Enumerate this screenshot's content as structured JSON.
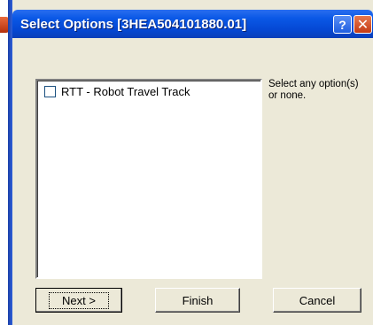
{
  "window": {
    "title": "Select Options [3HEA504101880.01]",
    "help_icon": "?",
    "close_icon": "✕"
  },
  "options": [
    {
      "label": "RTT - Robot Travel Track",
      "checked": false
    }
  ],
  "hint": "Select any option(s) or none.",
  "buttons": {
    "next": "Next >",
    "finish": "Finish",
    "cancel": "Cancel"
  }
}
